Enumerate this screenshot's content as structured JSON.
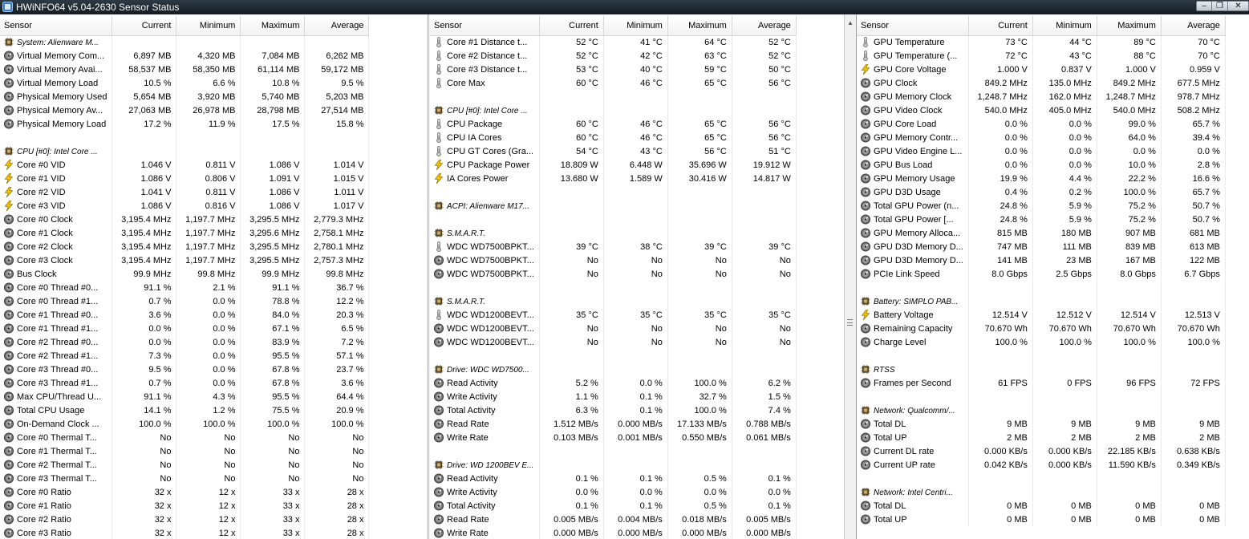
{
  "window": {
    "title": "HWiNFO64 v5.04-2630 Sensor Status",
    "icon": "hwinfo-app-icon",
    "buttons": [
      "minimize",
      "restore",
      "close"
    ]
  },
  "columns": [
    "Sensor",
    "Current",
    "Minimum",
    "Maximum",
    "Average"
  ],
  "panels": [
    {
      "rows": [
        {
          "t": "g",
          "name": "System: Alienware M..."
        },
        {
          "i": "o",
          "name": "Virtual Memory Com...",
          "v": [
            "6,897 MB",
            "4,320 MB",
            "7,084 MB",
            "6,262 MB"
          ]
        },
        {
          "i": "o",
          "name": "Virtual Memory Avai...",
          "v": [
            "58,537 MB",
            "58,350 MB",
            "61,114 MB",
            "59,172 MB"
          ]
        },
        {
          "i": "o",
          "name": "Virtual Memory Load",
          "v": [
            "10.5 %",
            "6.6 %",
            "10.8 %",
            "9.5 %"
          ]
        },
        {
          "i": "o",
          "name": "Physical Memory Used",
          "v": [
            "5,654 MB",
            "3,920 MB",
            "5,740 MB",
            "5,203 MB"
          ]
        },
        {
          "i": "o",
          "name": "Physical Memory Av...",
          "v": [
            "27,063 MB",
            "26,978 MB",
            "28,798 MB",
            "27,514 MB"
          ]
        },
        {
          "i": "o",
          "name": "Physical Memory Load",
          "v": [
            "17.2 %",
            "11.9 %",
            "17.5 %",
            "15.8 %"
          ]
        },
        {
          "t": "b"
        },
        {
          "t": "g",
          "name": "CPU [#0]: Intel Core ..."
        },
        {
          "i": "v",
          "name": "Core #0 VID",
          "v": [
            "1.046 V",
            "0.811 V",
            "1.086 V",
            "1.014 V"
          ]
        },
        {
          "i": "v",
          "name": "Core #1 VID",
          "v": [
            "1.086 V",
            "0.806 V",
            "1.091 V",
            "1.015 V"
          ]
        },
        {
          "i": "v",
          "name": "Core #2 VID",
          "v": [
            "1.041 V",
            "0.811 V",
            "1.086 V",
            "1.011 V"
          ]
        },
        {
          "i": "v",
          "name": "Core #3 VID",
          "v": [
            "1.086 V",
            "0.816 V",
            "1.086 V",
            "1.017 V"
          ]
        },
        {
          "i": "o",
          "name": "Core #0 Clock",
          "v": [
            "3,195.4 MHz",
            "1,197.7 MHz",
            "3,295.5 MHz",
            "2,779.3 MHz"
          ]
        },
        {
          "i": "o",
          "name": "Core #1 Clock",
          "v": [
            "3,195.4 MHz",
            "1,197.7 MHz",
            "3,295.6 MHz",
            "2,758.1 MHz"
          ]
        },
        {
          "i": "o",
          "name": "Core #2 Clock",
          "v": [
            "3,195.4 MHz",
            "1,197.7 MHz",
            "3,295.5 MHz",
            "2,780.1 MHz"
          ]
        },
        {
          "i": "o",
          "name": "Core #3 Clock",
          "v": [
            "3,195.4 MHz",
            "1,197.7 MHz",
            "3,295.5 MHz",
            "2,757.3 MHz"
          ]
        },
        {
          "i": "o",
          "name": "Bus Clock",
          "v": [
            "99.9 MHz",
            "99.8 MHz",
            "99.9 MHz",
            "99.8 MHz"
          ]
        },
        {
          "i": "o",
          "name": "Core #0 Thread #0...",
          "v": [
            "91.1 %",
            "2.1 %",
            "91.1 %",
            "36.7 %"
          ]
        },
        {
          "i": "o",
          "name": "Core #0 Thread #1...",
          "v": [
            "0.7 %",
            "0.0 %",
            "78.8 %",
            "12.2 %"
          ]
        },
        {
          "i": "o",
          "name": "Core #1 Thread #0...",
          "v": [
            "3.6 %",
            "0.0 %",
            "84.0 %",
            "20.3 %"
          ]
        },
        {
          "i": "o",
          "name": "Core #1 Thread #1...",
          "v": [
            "0.0 %",
            "0.0 %",
            "67.1 %",
            "6.5 %"
          ]
        },
        {
          "i": "o",
          "name": "Core #2 Thread #0...",
          "v": [
            "0.0 %",
            "0.0 %",
            "83.9 %",
            "7.2 %"
          ]
        },
        {
          "i": "o",
          "name": "Core #2 Thread #1...",
          "v": [
            "7.3 %",
            "0.0 %",
            "95.5 %",
            "57.1 %"
          ]
        },
        {
          "i": "o",
          "name": "Core #3 Thread #0...",
          "v": [
            "9.5 %",
            "0.0 %",
            "67.8 %",
            "23.7 %"
          ]
        },
        {
          "i": "o",
          "name": "Core #3 Thread #1...",
          "v": [
            "0.7 %",
            "0.0 %",
            "67.8 %",
            "3.6 %"
          ]
        },
        {
          "i": "o",
          "name": "Max CPU/Thread U...",
          "v": [
            "91.1 %",
            "4.3 %",
            "95.5 %",
            "64.4 %"
          ]
        },
        {
          "i": "o",
          "name": "Total CPU Usage",
          "v": [
            "14.1 %",
            "1.2 %",
            "75.5 %",
            "20.9 %"
          ]
        },
        {
          "i": "o",
          "name": "On-Demand Clock ...",
          "v": [
            "100.0 %",
            "100.0 %",
            "100.0 %",
            "100.0 %"
          ]
        },
        {
          "i": "o",
          "name": "Core #0 Thermal T...",
          "v": [
            "No",
            "No",
            "No",
            "No"
          ]
        },
        {
          "i": "o",
          "name": "Core #1 Thermal T...",
          "v": [
            "No",
            "No",
            "No",
            "No"
          ]
        },
        {
          "i": "o",
          "name": "Core #2 Thermal T...",
          "v": [
            "No",
            "No",
            "No",
            "No"
          ]
        },
        {
          "i": "o",
          "name": "Core #3 Thermal T...",
          "v": [
            "No",
            "No",
            "No",
            "No"
          ]
        },
        {
          "i": "o",
          "name": "Core #0 Ratio",
          "v": [
            "32 x",
            "12 x",
            "33 x",
            "28 x"
          ]
        },
        {
          "i": "o",
          "name": "Core #1 Ratio",
          "v": [
            "32 x",
            "12 x",
            "33 x",
            "28 x"
          ]
        },
        {
          "i": "o",
          "name": "Core #2 Ratio",
          "v": [
            "32 x",
            "12 x",
            "33 x",
            "28 x"
          ]
        },
        {
          "i": "o",
          "name": "Core #3 Ratio",
          "v": [
            "32 x",
            "12 x",
            "33 x",
            "28 x"
          ]
        }
      ]
    },
    {
      "rows": [
        {
          "i": "t",
          "name": "Core #1 Distance t...",
          "v": [
            "52 °C",
            "41 °C",
            "64 °C",
            "52 °C"
          ]
        },
        {
          "i": "t",
          "name": "Core #2 Distance t...",
          "v": [
            "52 °C",
            "42 °C",
            "63 °C",
            "52 °C"
          ]
        },
        {
          "i": "t",
          "name": "Core #3 Distance t...",
          "v": [
            "53 °C",
            "40 °C",
            "59 °C",
            "50 °C"
          ]
        },
        {
          "i": "t",
          "name": "Core Max",
          "v": [
            "60 °C",
            "46 °C",
            "65 °C",
            "56 °C"
          ]
        },
        {
          "t": "b"
        },
        {
          "t": "g",
          "name": "CPU [#0]: Intel Core ..."
        },
        {
          "i": "t",
          "name": "CPU Package",
          "v": [
            "60 °C",
            "46 °C",
            "65 °C",
            "56 °C"
          ]
        },
        {
          "i": "t",
          "name": "CPU IA Cores",
          "v": [
            "60 °C",
            "46 °C",
            "65 °C",
            "56 °C"
          ]
        },
        {
          "i": "t",
          "name": "CPU GT Cores (Gra...",
          "v": [
            "54 °C",
            "43 °C",
            "56 °C",
            "51 °C"
          ]
        },
        {
          "i": "v",
          "name": "CPU Package Power",
          "v": [
            "18.809 W",
            "6.448 W",
            "35.696 W",
            "19.912 W"
          ]
        },
        {
          "i": "v",
          "name": "IA Cores Power",
          "v": [
            "13.680 W",
            "1.589 W",
            "30.416 W",
            "14.817 W"
          ]
        },
        {
          "t": "b"
        },
        {
          "t": "g",
          "name": "ACPI: Alienware M17..."
        },
        {
          "t": "b"
        },
        {
          "t": "g",
          "name": "S.M.A.R.T."
        },
        {
          "i": "t",
          "name": "WDC WD7500BPKT...",
          "v": [
            "39 °C",
            "38 °C",
            "39 °C",
            "39 °C"
          ]
        },
        {
          "i": "o",
          "name": "WDC WD7500BPKT...",
          "v": [
            "No",
            "No",
            "No",
            "No"
          ]
        },
        {
          "i": "o",
          "name": "WDC WD7500BPKT...",
          "v": [
            "No",
            "No",
            "No",
            "No"
          ]
        },
        {
          "t": "b"
        },
        {
          "t": "g",
          "name": "S.M.A.R.T."
        },
        {
          "i": "t",
          "name": "WDC WD1200BEVT...",
          "v": [
            "35 °C",
            "35 °C",
            "35 °C",
            "35 °C"
          ]
        },
        {
          "i": "o",
          "name": "WDC WD1200BEVT...",
          "v": [
            "No",
            "No",
            "No",
            "No"
          ]
        },
        {
          "i": "o",
          "name": "WDC WD1200BEVT...",
          "v": [
            "No",
            "No",
            "No",
            "No"
          ]
        },
        {
          "t": "b"
        },
        {
          "t": "g",
          "name": "Drive: WDC WD7500..."
        },
        {
          "i": "o",
          "name": "Read Activity",
          "v": [
            "5.2 %",
            "0.0 %",
            "100.0 %",
            "6.2 %"
          ]
        },
        {
          "i": "o",
          "name": "Write Activity",
          "v": [
            "1.1 %",
            "0.1 %",
            "32.7 %",
            "1.5 %"
          ]
        },
        {
          "i": "o",
          "name": "Total Activity",
          "v": [
            "6.3 %",
            "0.1 %",
            "100.0 %",
            "7.4 %"
          ]
        },
        {
          "i": "o",
          "name": "Read Rate",
          "v": [
            "1.512 MB/s",
            "0.000 MB/s",
            "17.133 MB/s",
            "0.788 MB/s"
          ]
        },
        {
          "i": "o",
          "name": "Write Rate",
          "v": [
            "0.103 MB/s",
            "0.001 MB/s",
            "0.550 MB/s",
            "0.061 MB/s"
          ]
        },
        {
          "t": "b"
        },
        {
          "t": "g",
          "name": "Drive: WD 1200BEV E..."
        },
        {
          "i": "o",
          "name": "Read Activity",
          "v": [
            "0.1 %",
            "0.1 %",
            "0.5 %",
            "0.1 %"
          ]
        },
        {
          "i": "o",
          "name": "Write Activity",
          "v": [
            "0.0 %",
            "0.0 %",
            "0.0 %",
            "0.0 %"
          ]
        },
        {
          "i": "o",
          "name": "Total Activity",
          "v": [
            "0.1 %",
            "0.1 %",
            "0.5 %",
            "0.1 %"
          ]
        },
        {
          "i": "o",
          "name": "Read Rate",
          "v": [
            "0.005 MB/s",
            "0.004 MB/s",
            "0.018 MB/s",
            "0.005 MB/s"
          ]
        },
        {
          "i": "o",
          "name": "Write Rate",
          "v": [
            "0.000 MB/s",
            "0.000 MB/s",
            "0.000 MB/s",
            "0.000 MB/s"
          ]
        }
      ]
    },
    {
      "rows": [
        {
          "i": "t",
          "name": "GPU Temperature",
          "v": [
            "73 °C",
            "44 °C",
            "89 °C",
            "70 °C"
          ]
        },
        {
          "i": "t",
          "name": "GPU Temperature (...",
          "v": [
            "72 °C",
            "43 °C",
            "88 °C",
            "70 °C"
          ]
        },
        {
          "i": "v",
          "name": "GPU Core Voltage",
          "v": [
            "1.000 V",
            "0.837 V",
            "1.000 V",
            "0.959 V"
          ]
        },
        {
          "i": "o",
          "name": "GPU Clock",
          "v": [
            "849.2 MHz",
            "135.0 MHz",
            "849.2 MHz",
            "677.5 MHz"
          ]
        },
        {
          "i": "o",
          "name": "GPU Memory Clock",
          "v": [
            "1,248.7 MHz",
            "162.0 MHz",
            "1,248.7 MHz",
            "978.7 MHz"
          ]
        },
        {
          "i": "o",
          "name": "GPU Video Clock",
          "v": [
            "540.0 MHz",
            "405.0 MHz",
            "540.0 MHz",
            "508.2 MHz"
          ]
        },
        {
          "i": "o",
          "name": "GPU Core Load",
          "v": [
            "0.0 %",
            "0.0 %",
            "99.0 %",
            "65.7 %"
          ]
        },
        {
          "i": "o",
          "name": "GPU Memory Contr...",
          "v": [
            "0.0 %",
            "0.0 %",
            "64.0 %",
            "39.4 %"
          ]
        },
        {
          "i": "o",
          "name": "GPU Video Engine L...",
          "v": [
            "0.0 %",
            "0.0 %",
            "0.0 %",
            "0.0 %"
          ]
        },
        {
          "i": "o",
          "name": "GPU Bus Load",
          "v": [
            "0.0 %",
            "0.0 %",
            "10.0 %",
            "2.8 %"
          ]
        },
        {
          "i": "o",
          "name": "GPU Memory Usage",
          "v": [
            "19.9 %",
            "4.4 %",
            "22.2 %",
            "16.6 %"
          ]
        },
        {
          "i": "o",
          "name": "GPU D3D Usage",
          "v": [
            "0.4 %",
            "0.2 %",
            "100.0 %",
            "65.7 %"
          ]
        },
        {
          "i": "o",
          "name": "Total GPU Power (n...",
          "v": [
            "24.8 %",
            "5.9 %",
            "75.2 %",
            "50.7 %"
          ]
        },
        {
          "i": "o",
          "name": "Total GPU Power [...",
          "v": [
            "24.8 %",
            "5.9 %",
            "75.2 %",
            "50.7 %"
          ]
        },
        {
          "i": "o",
          "name": "GPU Memory Alloca...",
          "v": [
            "815 MB",
            "180 MB",
            "907 MB",
            "681 MB"
          ]
        },
        {
          "i": "o",
          "name": "GPU D3D Memory D...",
          "v": [
            "747 MB",
            "111 MB",
            "839 MB",
            "613 MB"
          ]
        },
        {
          "i": "o",
          "name": "GPU D3D Memory D...",
          "v": [
            "141 MB",
            "23 MB",
            "167 MB",
            "122 MB"
          ]
        },
        {
          "i": "o",
          "name": "PCIe Link Speed",
          "v": [
            "8.0 Gbps",
            "2.5 Gbps",
            "8.0 Gbps",
            "6.7 Gbps"
          ]
        },
        {
          "t": "b"
        },
        {
          "t": "g",
          "name": "Battery: SIMPLO PAB..."
        },
        {
          "i": "v",
          "name": "Battery Voltage",
          "v": [
            "12.514 V",
            "12.512 V",
            "12.514 V",
            "12.513 V"
          ]
        },
        {
          "i": "o",
          "name": "Remaining Capacity",
          "v": [
            "70.670 Wh",
            "70.670 Wh",
            "70.670 Wh",
            "70.670 Wh"
          ]
        },
        {
          "i": "o",
          "name": "Charge Level",
          "v": [
            "100.0 %",
            "100.0 %",
            "100.0 %",
            "100.0 %"
          ]
        },
        {
          "t": "b"
        },
        {
          "t": "g",
          "name": "RTSS"
        },
        {
          "i": "o",
          "name": "Frames per Second",
          "v": [
            "61 FPS",
            "0 FPS",
            "96 FPS",
            "72 FPS"
          ]
        },
        {
          "t": "b"
        },
        {
          "t": "g",
          "name": "Network: Qualcomm/..."
        },
        {
          "i": "o",
          "name": "Total DL",
          "v": [
            "9 MB",
            "9 MB",
            "9 MB",
            "9 MB"
          ]
        },
        {
          "i": "o",
          "name": "Total UP",
          "v": [
            "2 MB",
            "2 MB",
            "2 MB",
            "2 MB"
          ]
        },
        {
          "i": "o",
          "name": "Current DL rate",
          "v": [
            "0.000 KB/s",
            "0.000 KB/s",
            "22.185 KB/s",
            "0.638 KB/s"
          ]
        },
        {
          "i": "o",
          "name": "Current UP rate",
          "v": [
            "0.042 KB/s",
            "0.000 KB/s",
            "11.590 KB/s",
            "0.349 KB/s"
          ]
        },
        {
          "t": "b"
        },
        {
          "t": "g",
          "name": "Network: Intel Centri..."
        },
        {
          "i": "o",
          "name": "Total DL",
          "v": [
            "0 MB",
            "0 MB",
            "0 MB",
            "0 MB"
          ]
        },
        {
          "i": "o",
          "name": "Total UP",
          "v": [
            "0 MB",
            "0 MB",
            "0 MB",
            "0 MB"
          ]
        }
      ]
    }
  ],
  "icons": {
    "o": "gauge-icon",
    "v": "lightning-icon",
    "t": "thermometer-icon",
    "g": "chip-icon"
  }
}
